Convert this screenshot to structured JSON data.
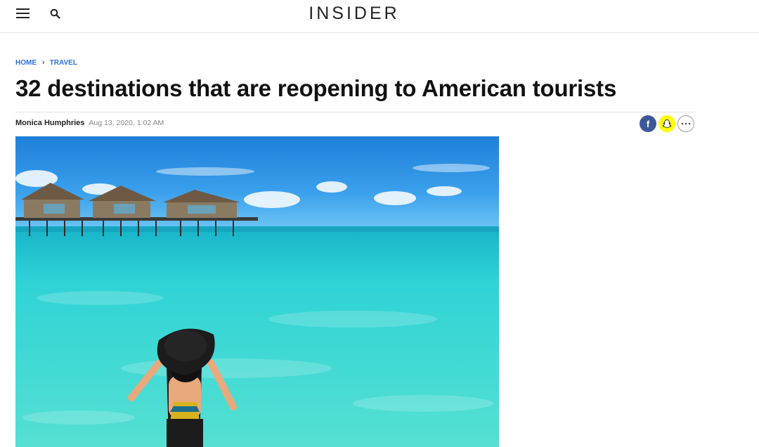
{
  "header": {
    "logo": "INSIDER",
    "menu_icon": "hamburger-menu-icon",
    "search_icon": "search-icon"
  },
  "breadcrumb": {
    "items": [
      "HOME",
      "TRAVEL"
    ],
    "separator_icon": "chevron-right-icon"
  },
  "article": {
    "title": "32 destinations that are reopening to American tourists",
    "author": "Monica Humphries",
    "date": "Aug 13, 2020, 1:02 AM"
  },
  "share": {
    "buttons": [
      {
        "name": "facebook",
        "icon": "facebook-icon",
        "label": "f",
        "color": "#3b5998"
      },
      {
        "name": "snapchat",
        "icon": "snapchat-icon",
        "color": "#fffc00"
      },
      {
        "name": "more",
        "icon": "more-dots-icon"
      }
    ]
  },
  "hero_image": {
    "subject": "Woman in wide-brimmed black hat wading in turquoise water facing overwater bungalows",
    "colors": {
      "sky": "#2f8fe0",
      "water": "#3fd6d0",
      "hat": "#1c1c1c"
    }
  },
  "colors": {
    "accent_link": "#2b70d8",
    "title_text": "#111111",
    "meta_text": "#888888"
  }
}
